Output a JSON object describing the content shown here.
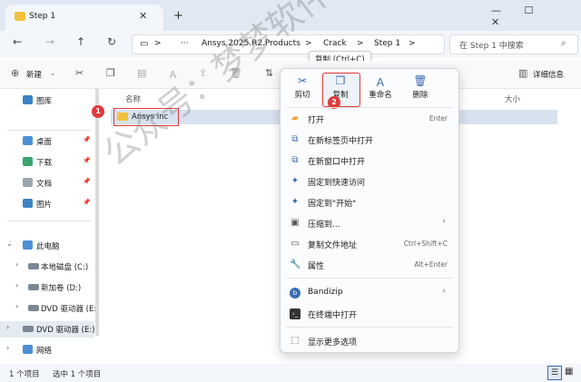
{
  "window": {
    "tab_title": "Step 1",
    "tab_close": "✕",
    "new_tab": "+",
    "controls": [
      "—",
      "☐",
      "✕"
    ]
  },
  "address": {
    "path": [
      "Ansys.2025.R2.Products",
      "Crack",
      "Step 1"
    ],
    "separator": ">",
    "ellipsis": "···",
    "search_placeholder": "在 Step 1 中搜索"
  },
  "toolbar": {
    "new_label": "新建",
    "details_label": "详细信息"
  },
  "tooltip": "复制 (Ctrl+C)",
  "sidebar": {
    "items": [
      {
        "label": "图库",
        "icon": "gallery-icon"
      },
      {
        "label": "桌面",
        "icon": "desktop-icon",
        "pinned": true
      },
      {
        "label": "下载",
        "icon": "download-icon",
        "pinned": true
      },
      {
        "label": "文档",
        "icon": "document-icon",
        "pinned": true
      },
      {
        "label": "图片",
        "icon": "pictures-icon",
        "pinned": true
      },
      {
        "label": "此电脑",
        "icon": "pc-icon",
        "expanded": true
      },
      {
        "label": "本地磁盘 (C:)",
        "icon": "drive-icon"
      },
      {
        "label": "新加卷 (D:)",
        "icon": "drive-icon"
      },
      {
        "label": "DVD 驱动器 (E:",
        "icon": "dvd-icon"
      },
      {
        "label": "DVD 驱动器 (E:)",
        "icon": "dvd-icon",
        "selected": true
      },
      {
        "label": "网络",
        "icon": "network-icon"
      }
    ]
  },
  "filelist": {
    "col_name": "名称",
    "col_size": "大小",
    "rows": [
      {
        "name": "Ansys Inc"
      }
    ]
  },
  "badges": [
    "1",
    "2"
  ],
  "context_menu": {
    "quick_actions": [
      {
        "label": "剪切",
        "icon": "cut-icon"
      },
      {
        "label": "复制",
        "icon": "copy-icon"
      },
      {
        "label": "重命名",
        "icon": "rename-icon"
      },
      {
        "label": "删除",
        "icon": "delete-icon"
      }
    ],
    "items": [
      {
        "label": "打开",
        "shortcut": "Enter",
        "icon": "open-icon"
      },
      {
        "label": "在新标签页中打开",
        "shortcut": "",
        "icon": "new-tab-icon"
      },
      {
        "label": "在新窗口中打开",
        "shortcut": "",
        "icon": "new-window-icon"
      },
      {
        "label": "固定到快速访问",
        "shortcut": "",
        "icon": "pin-icon"
      },
      {
        "label": "固定到\"开始\"",
        "shortcut": "",
        "icon": "pin-start-icon"
      },
      {
        "label": "压缩到...",
        "shortcut": "",
        "icon": "compress-icon",
        "submenu": true
      },
      {
        "label": "复制文件地址",
        "shortcut": "Ctrl+Shift+C",
        "icon": "copy-path-icon"
      },
      {
        "label": "属性",
        "shortcut": "Alt+Enter",
        "icon": "properties-icon"
      },
      {
        "label": "Bandizip",
        "shortcut": "",
        "icon": "bandizip-icon",
        "submenu": true
      },
      {
        "label": "在终端中打开",
        "shortcut": "",
        "icon": "terminal-icon"
      },
      {
        "label": "显示更多选项",
        "shortcut": "",
        "icon": "more-options-icon"
      }
    ]
  },
  "status": {
    "count": "1 个项目",
    "selected": "选中 1 个项目"
  },
  "watermark": "公众号：梦梦软件管家",
  "colors": {
    "accent": "#3a6ab0",
    "highlight": "#e03a3a",
    "folder": "#f2c13d"
  }
}
